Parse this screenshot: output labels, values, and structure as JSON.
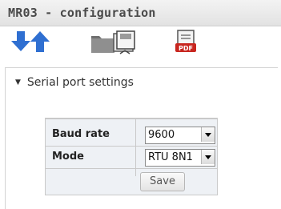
{
  "window": {
    "title": "MR03 - configuration"
  },
  "toolbar": {
    "icons": [
      "arrow-down-icon",
      "arrow-up-icon",
      "folder-save-icon",
      "pdf-icon"
    ]
  },
  "section": {
    "title": "Serial port settings",
    "expanded": true
  },
  "form": {
    "fields": [
      {
        "label": "Baud rate",
        "value": "9600"
      },
      {
        "label": "Mode",
        "value": "RTU 8N1"
      }
    ],
    "save_label": "Save"
  },
  "colors": {
    "arrow_blue": "#2f6fd1",
    "panel_border": "#d4d4d4",
    "form_bg": "#eef1f5"
  }
}
